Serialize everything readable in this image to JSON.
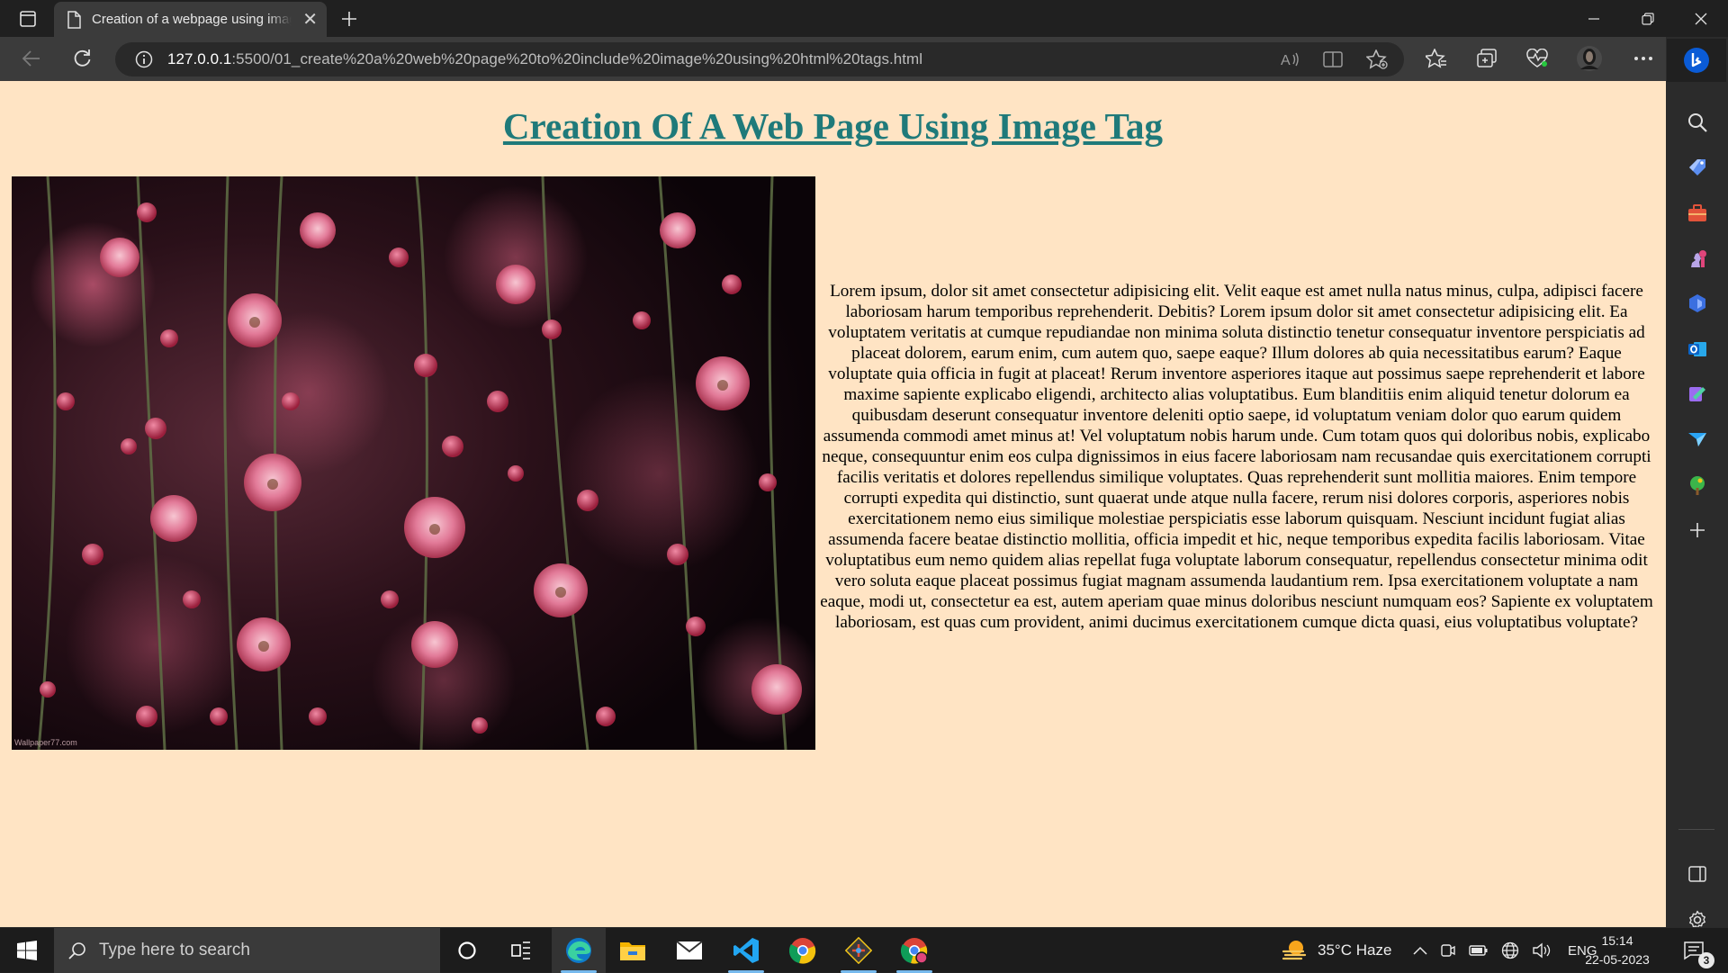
{
  "browser": {
    "tab_title": "Creation of a webpage using image tag",
    "url_host": "127.0.0.1",
    "url_path": ":5500/01_create%20a%20web%20page%20to%20include%20image%20using%20html%20tags.html"
  },
  "page": {
    "heading": "Creation Of A Web Page Using Image Tag",
    "image_watermark": "Wallpaper77.com",
    "paragraph": "Lorem ipsum, dolor sit amet consectetur adipisicing elit. Velit eaque est amet nulla natus minus, culpa, adipisci facere laboriosam harum temporibus reprehenderit. Debitis? Lorem ipsum dolor sit amet consectetur adipisicing elit. Ea voluptatem veritatis at cumque repudiandae non minima soluta distinctio tenetur consequatur inventore perspiciatis ad placeat dolorem, earum enim, cum autem quo, saepe eaque? Illum dolores ab quia necessitatibus earum? Eaque voluptate quia officia in fugit at placeat! Rerum inventore asperiores itaque aut possimus saepe reprehenderit et labore maxime sapiente explicabo eligendi, architecto alias voluptatibus. Eum blanditiis enim aliquid tenetur dolorum ea quibusdam deserunt consequatur inventore deleniti optio saepe, id voluptatum veniam dolor quo earum quidem assumenda commodi amet minus at! Vel voluptatum nobis harum unde. Cum totam quos qui doloribus nobis, explicabo neque, consequuntur enim eos culpa dignissimos in eius facere laboriosam nam recusandae quis exercitationem corrupti facilis veritatis et dolores repellendus similique voluptates. Quas reprehenderit sunt mollitia maiores. Enim tempore corrupti expedita qui distinctio, sunt quaerat unde atque nulla facere, rerum nisi dolores corporis, asperiores nobis exercitationem nemo eius similique molestiae perspiciatis esse laborum quisquam. Nesciunt incidunt fugiat alias assumenda facere beatae distinctio mollitia, officia impedit et hic, neque temporibus expedita facilis laboriosam. Vitae voluptatibus eum nemo quidem alias repellat fuga voluptate laborum consequatur, repellendus consectetur minima odit vero soluta eaque placeat possimus fugiat magnam assumenda laudantium rem. Ipsa exercitationem voluptate a nam eaque, modi ut, consectetur ea est, autem aperiam quae minus doloribus nesciunt numquam eos? Sapiente ex voluptatem laboriosam, est quas cum provident, animi ducimus exercitationem cumque dicta quasi, eius voluptatibus voluptate?"
  },
  "taskbar": {
    "search_placeholder": "Type here to search",
    "weather": "35°C Haze",
    "language": "ENG",
    "time": "15:14",
    "date": "22-05-2023",
    "notification_count": "3"
  },
  "colors": {
    "page_background": "#ffe4c4",
    "heading": "#1f7a7a",
    "accent": "#76b9ed"
  },
  "icons": {
    "sidebar": [
      "search-icon",
      "tag-icon",
      "briefcase-icon",
      "chess-icon",
      "copilot-icon",
      "outlook-icon",
      "designer-icon",
      "send-icon",
      "tree-icon",
      "add-icon",
      "split-screen-icon",
      "settings-icon"
    ],
    "taskbar_apps": [
      "cortana-icon",
      "task-view-icon",
      "edge-icon",
      "file-explorer-icon",
      "mail-icon",
      "vscode-icon",
      "chrome-icon",
      "git-icon",
      "chrome-profile-icon"
    ]
  }
}
